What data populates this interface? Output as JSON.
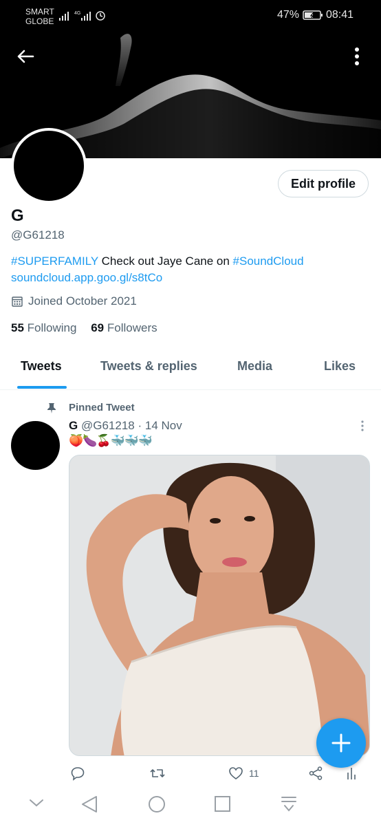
{
  "status_bar": {
    "carrier_line1": "SMART",
    "carrier_line2": "GLOBE",
    "battery": "47%",
    "time": "08:41"
  },
  "header": {
    "back_icon": "arrow-left-icon",
    "more_icon": "more-vertical-icon"
  },
  "profile": {
    "edit_label": "Edit profile",
    "name": "G",
    "handle": "@G61218",
    "bio": {
      "hashtag1": "#SUPERFAMILY",
      "text": " Check out Jaye Cane on ",
      "hashtag2": "#SoundCloud",
      "link": "soundcloud.app.goo.gl/s8tCo"
    },
    "joined": "Joined October 2021",
    "following_count": "55",
    "following_label": "Following",
    "followers_count": "69",
    "followers_label": "Followers"
  },
  "tabs": [
    {
      "label": "Tweets",
      "active": true
    },
    {
      "label": "Tweets & replies",
      "active": false
    },
    {
      "label": "Media",
      "active": false
    },
    {
      "label": "Likes",
      "active": false
    }
  ],
  "tweet": {
    "pinned_label": "Pinned Tweet",
    "author_name": "G",
    "author_handle": "@G61218",
    "separator": "·",
    "date": "14 Nov",
    "emojis": "🍑🍆🍒🐳🐳🐳",
    "like_count": "11"
  },
  "colors": {
    "accent": "#1d9bf0",
    "secondary_text": "#536471",
    "primary_text": "#0f1419"
  }
}
